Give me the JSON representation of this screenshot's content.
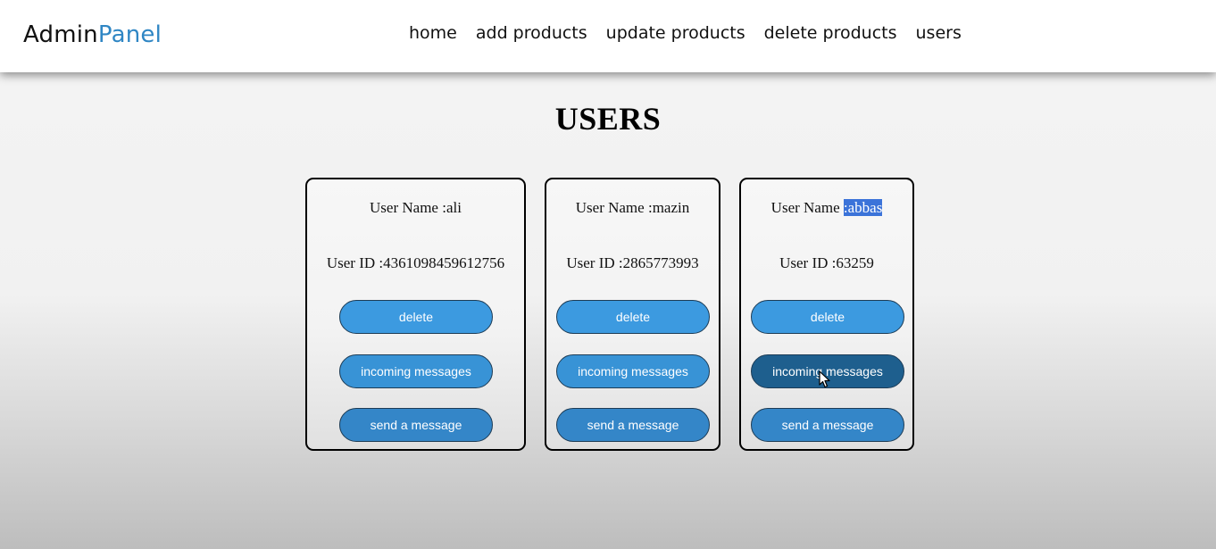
{
  "header": {
    "logo_main": "Admin",
    "logo_accent": "Panel",
    "nav": [
      "home",
      "add products",
      "update products",
      "delete products",
      "users"
    ]
  },
  "page": {
    "title": "USERS"
  },
  "users": [
    {
      "name_label": "User Name :",
      "name": "ali",
      "id_label": "User ID :",
      "id": "4361098459612756",
      "delete": "delete",
      "incoming": "incoming messages",
      "send": "send a message"
    },
    {
      "name_label": "User Name :",
      "name": "mazin",
      "id_label": "User ID :",
      "id": "2865773993",
      "delete": "delete",
      "incoming": "incoming messages",
      "send": "send a message"
    },
    {
      "name_label": "User Name ",
      "name": ":abbas",
      "id_label": "User ID :",
      "id": "63259",
      "delete": "delete",
      "incoming": "incoming messages",
      "send": "send a message"
    }
  ],
  "colors": {
    "accent": "#2f86c4",
    "button": "#3c9ae0",
    "button_active": "#1e5f8e",
    "selection": "#3b73d9"
  }
}
